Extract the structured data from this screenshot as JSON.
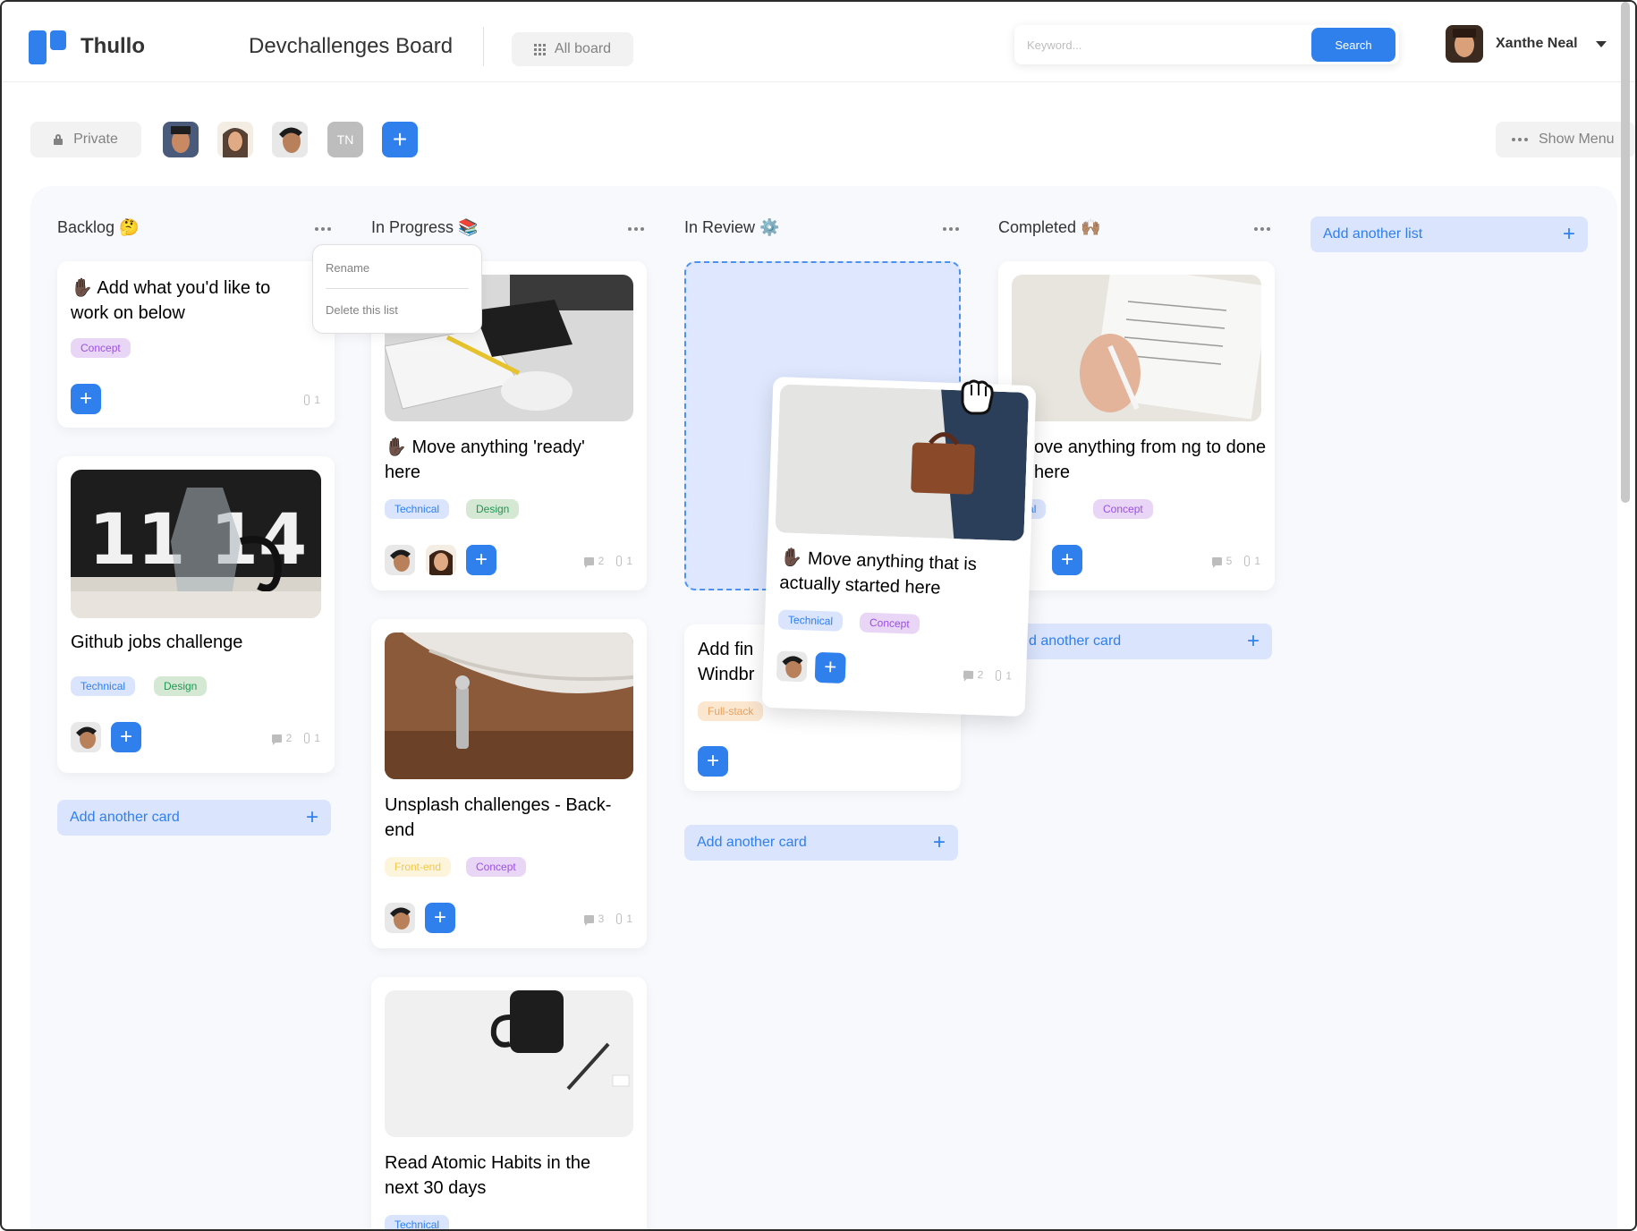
{
  "header": {
    "app_name": "Thullo",
    "board_title": "Devchallenges Board",
    "all_board_label": "All board",
    "search_placeholder": "Keyword...",
    "search_button": "Search",
    "user_name": "Xanthe Neal"
  },
  "toolbar": {
    "private_label": "Private",
    "member_initials": "TN",
    "show_menu_label": "Show Menu"
  },
  "lists": {
    "backlog": {
      "title": "Backlog 🤔",
      "cards": [
        {
          "title": "✋🏿 Add what you'd like to work on below",
          "tags": [
            "Concept"
          ],
          "attachments": "1"
        },
        {
          "title": "Github jobs challenge",
          "tags": [
            "Technical",
            "Design"
          ],
          "comments": "2",
          "attachments": "1"
        }
      ],
      "add_label": "Add another card"
    },
    "in_progress": {
      "title": "In Progress 📚",
      "menu": {
        "rename": "Rename",
        "delete": "Delete this list"
      },
      "cards": [
        {
          "title": "✋🏿 Move anything 'ready' here",
          "tags": [
            "Technical",
            "Design"
          ],
          "comments": "2",
          "attachments": "1"
        },
        {
          "title": "Unsplash challenges - Back-end",
          "tags": [
            "Front-end",
            "Concept"
          ],
          "comments": "3",
          "attachments": "1"
        },
        {
          "title": "Read Atomic Habits in the next 30 days",
          "tags": [
            "Technical"
          ]
        }
      ]
    },
    "in_review": {
      "title": "In Review ⚙️",
      "cards": [
        {
          "title": "Add fin Windbr",
          "tags": [
            "Full-stack"
          ]
        }
      ],
      "add_label": "Add another card",
      "dragged_card": {
        "title": "✋🏿 Move anything that is actually started here",
        "tags": [
          "Technical",
          "Concept"
        ],
        "comments": "2",
        "attachments": "1"
      }
    },
    "completed": {
      "title": "Completed 🙌🏽",
      "cards": [
        {
          "title": "ove anything from ng to done here",
          "tags": [
            "hnical",
            "Concept"
          ],
          "comments": "5",
          "attachments": "1"
        }
      ],
      "add_label": "d another card"
    },
    "add_list_label": "Add another list"
  },
  "colors": {
    "accent": "#2f80ed",
    "board_bg": "#f8f9fd"
  }
}
